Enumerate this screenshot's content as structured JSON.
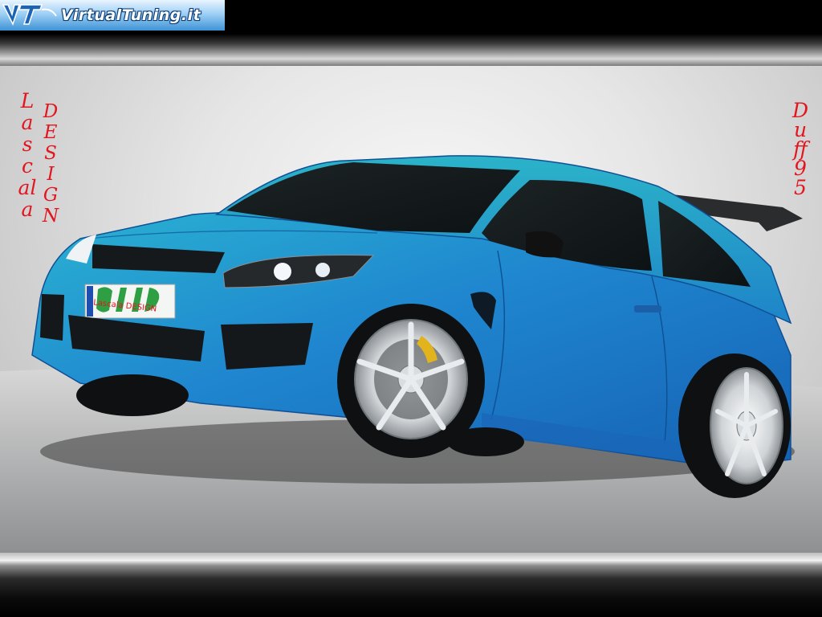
{
  "site": {
    "logo_mark": "VT",
    "logo_text": "VirtualTuning.it"
  },
  "signature": {
    "line1": "Lascala",
    "line2": "DESIGN",
    "author": "Duff95"
  },
  "plate": {
    "text": "Lascala DESIGN"
  },
  "colors": {
    "car_body": "#1e78c8",
    "car_highlight": "#2aa7c9",
    "signature_red": "#e2161f",
    "plate_green": "#2ea043",
    "caliper_yellow": "#e1b31c"
  }
}
